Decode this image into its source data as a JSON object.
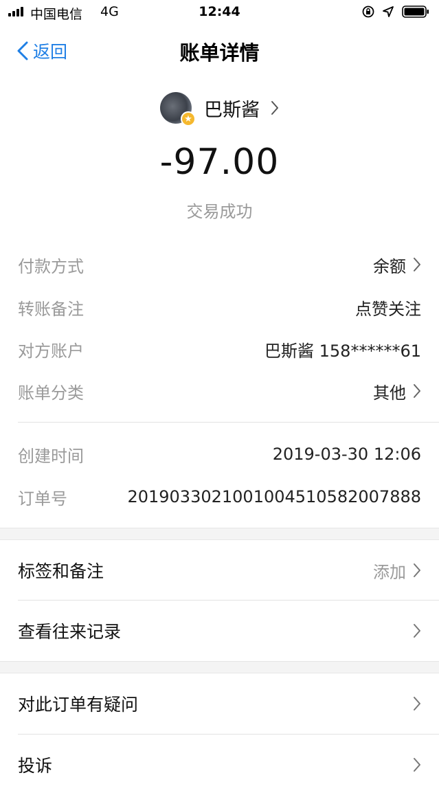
{
  "status_bar": {
    "carrier": "中国电信",
    "network": "4G",
    "time": "12:44"
  },
  "nav": {
    "back_label": "返回",
    "title": "账单详情"
  },
  "party": {
    "name": "巴斯酱",
    "badge_icon": "star-icon"
  },
  "amount": "-97.00",
  "status_text": "交易成功",
  "details": {
    "payment_method": {
      "label": "付款方式",
      "value": "余额"
    },
    "transfer_note": {
      "label": "转账备注",
      "value": "点赞关注"
    },
    "counterparty_account": {
      "label": "对方账户",
      "value": "巴斯酱 158******61"
    },
    "bill_category": {
      "label": "账单分类",
      "value": "其他"
    },
    "created_time": {
      "label": "创建时间",
      "value": "2019-03-30 12:06"
    },
    "order_number": {
      "label": "订单号",
      "value": "20190330210010045105820078​88"
    }
  },
  "actions": {
    "tags_notes": {
      "label": "标签和备注",
      "value": "添加"
    },
    "view_history": {
      "label": "查看往来记录"
    },
    "order_question": {
      "label": "对此订单有疑问"
    },
    "complaint": {
      "label": "投诉"
    }
  },
  "colors": {
    "accent": "#1f7fe5",
    "muted_text": "#9a9a9a",
    "section_bg": "#f4f4f4"
  }
}
